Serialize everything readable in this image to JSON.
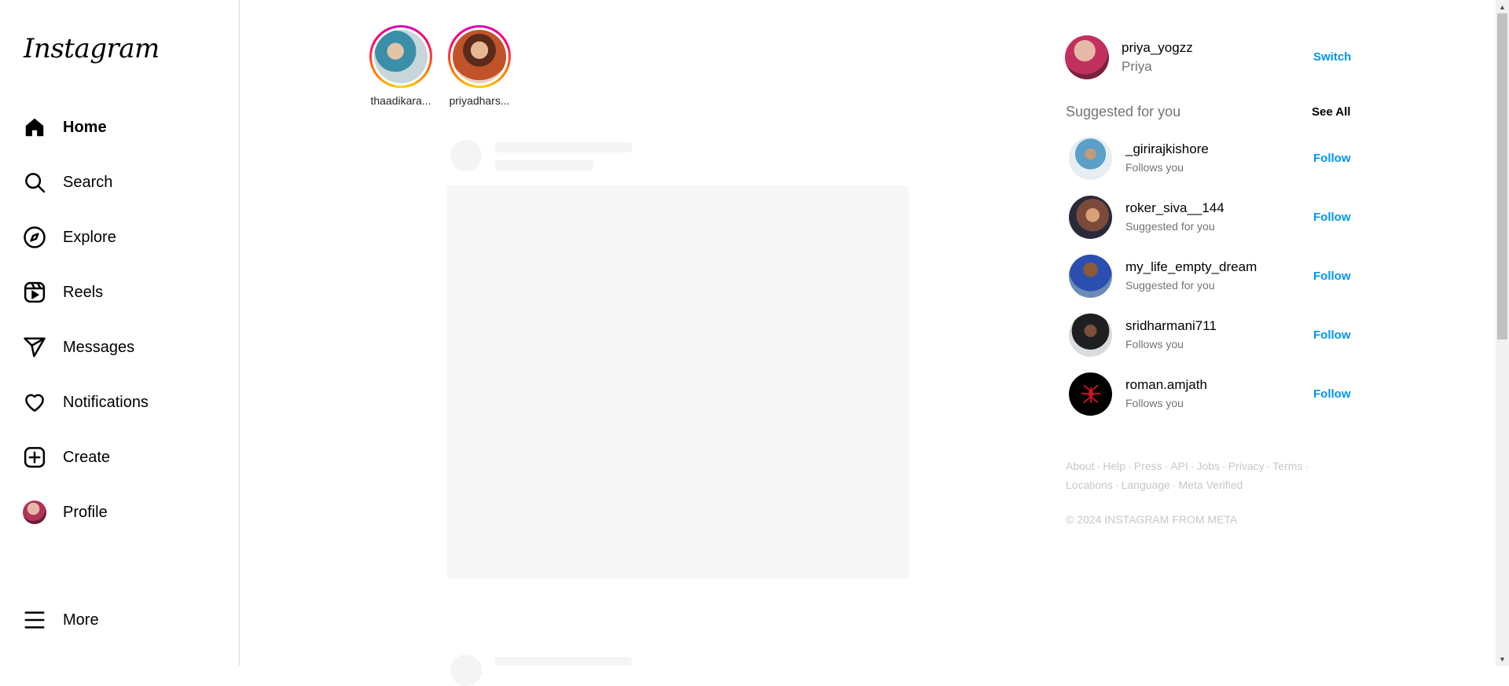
{
  "brand": {
    "logo_text": "Instagram"
  },
  "nav": {
    "home": "Home",
    "search": "Search",
    "explore": "Explore",
    "reels": "Reels",
    "messages": "Messages",
    "notifications": "Notifications",
    "create": "Create",
    "profile": "Profile",
    "more": "More"
  },
  "stories": [
    {
      "username": "thaadikara..."
    },
    {
      "username": "priyadhars..."
    }
  ],
  "current_user": {
    "username": "priya_yogzz",
    "full_name": "Priya",
    "switch_label": "Switch"
  },
  "suggestions": {
    "heading": "Suggested for you",
    "see_all": "See All",
    "follow_label": "Follow",
    "items": [
      {
        "username": "_girirajkishore",
        "reason": "Follows you"
      },
      {
        "username": "roker_siva__144",
        "reason": "Suggested for you"
      },
      {
        "username": "my_life_empty_dream",
        "reason": "Suggested for you"
      },
      {
        "username": "sridharmani711",
        "reason": "Follows you"
      },
      {
        "username": "roman.amjath",
        "reason": "Follows you"
      }
    ]
  },
  "footer": {
    "links": [
      "About",
      "Help",
      "Press",
      "API",
      "Jobs",
      "Privacy",
      "Terms",
      "Locations",
      "Language",
      "Meta Verified"
    ],
    "separator": "·",
    "copyright": "© 2024 INSTAGRAM FROM META"
  },
  "colors": {
    "accent": "#0095f6",
    "muted": "#737373",
    "faint": "#c7c7c7",
    "border": "#dbdbdb"
  }
}
